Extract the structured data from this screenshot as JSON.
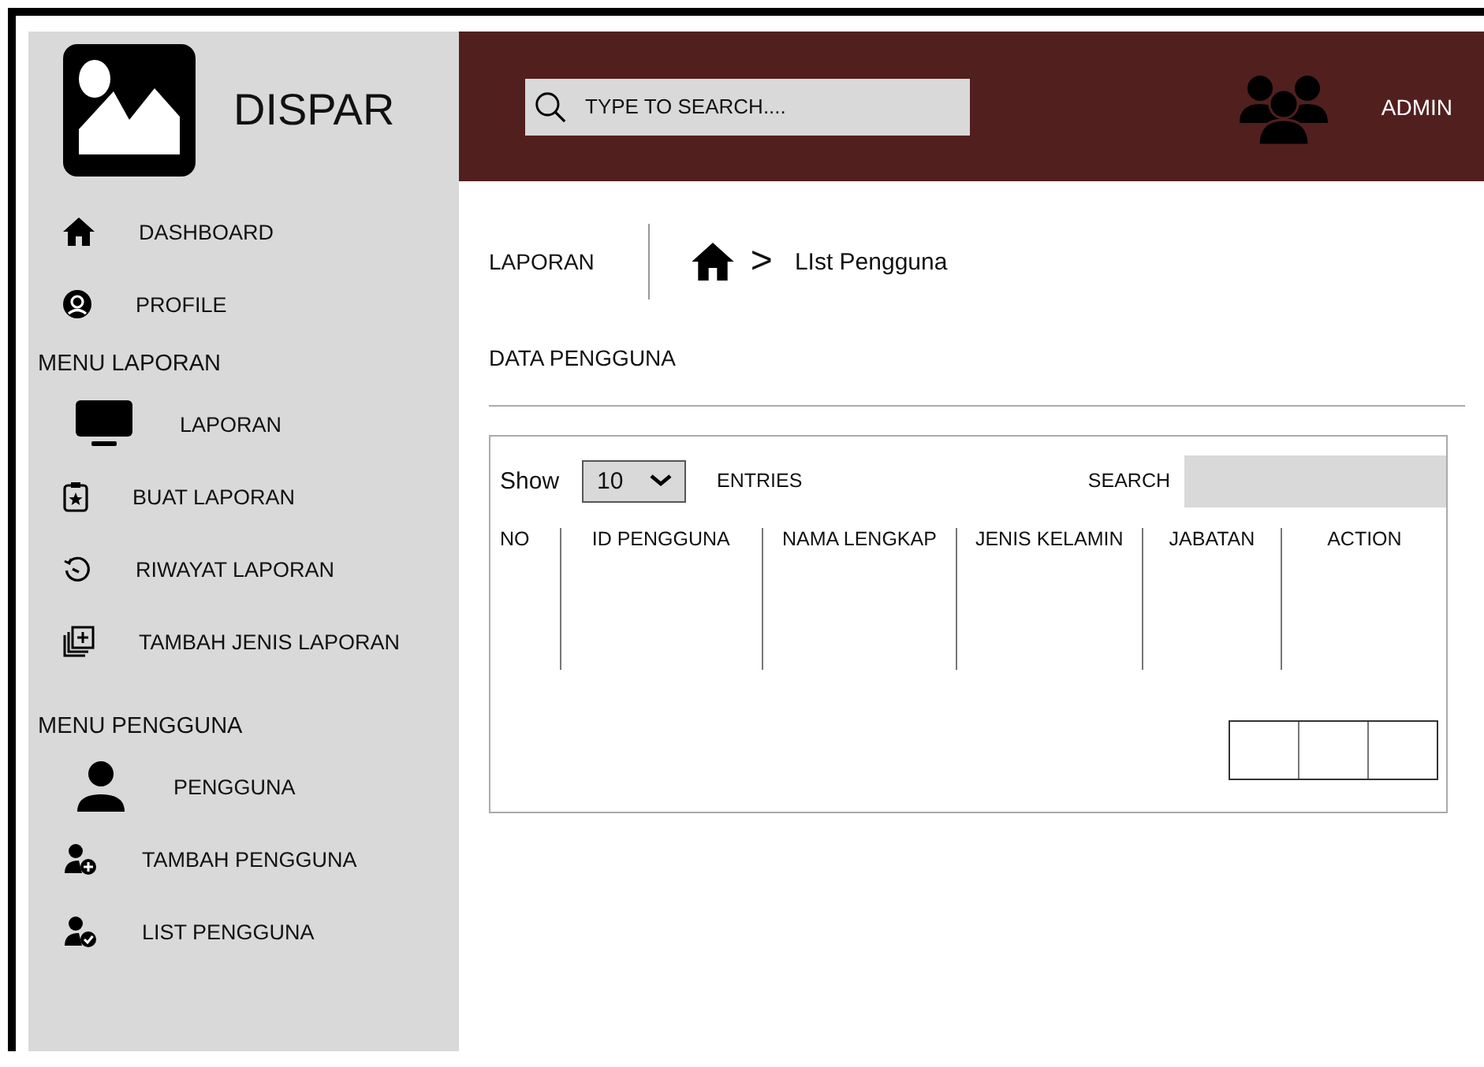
{
  "brand": {
    "name": "DISPAR"
  },
  "sidebar": {
    "items": [
      {
        "label": "DASHBOARD"
      },
      {
        "label": "PROFILE"
      }
    ],
    "sections": [
      {
        "title": "MENU LAPORAN",
        "items": [
          {
            "label": "LAPORAN"
          },
          {
            "label": "BUAT LAPORAN"
          },
          {
            "label": "RIWAYAT LAPORAN"
          },
          {
            "label": "TAMBAH JENIS LAPORAN"
          }
        ]
      },
      {
        "title": "MENU PENGGUNA",
        "items": [
          {
            "label": "PENGGUNA"
          },
          {
            "label": "TAMBAH PENGGUNA"
          },
          {
            "label": "LIST PENGGUNA"
          }
        ]
      }
    ]
  },
  "header": {
    "search": {
      "placeholder": "TYPE TO SEARCH...."
    },
    "user": "ADMIN"
  },
  "page": {
    "title": "LAPORAN",
    "breadcrumb": {
      "separator": ">",
      "current": "LIst Pengguna"
    },
    "section_title": "DATA PENGGUNA"
  },
  "table_controls": {
    "show_label": "Show",
    "page_size": "10",
    "entries_label": "ENTRIES",
    "search_label": "SEARCH"
  },
  "table": {
    "columns": [
      "NO",
      "ID PENGGUNA",
      "NAMA LENGKAP",
      "JENIS KELAMIN",
      "JABATAN",
      "ACTION"
    ]
  }
}
